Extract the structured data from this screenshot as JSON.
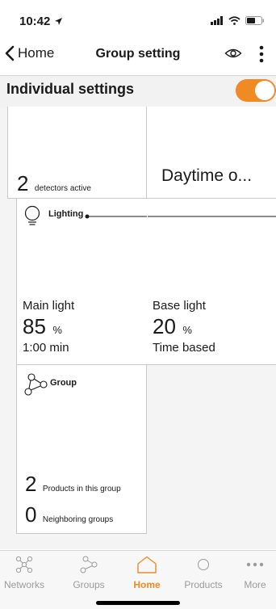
{
  "status_bar": {
    "time": "10:42"
  },
  "nav": {
    "back_label": "Home",
    "title": "Group setting"
  },
  "section": {
    "title": "Individual settings",
    "toggle_on": true
  },
  "tiles": {
    "detectors": {
      "count": "2",
      "label": "detectors active"
    },
    "daytime": {
      "text": "Daytime o..."
    },
    "lighting": {
      "title": "Lighting",
      "main_label": "Main light",
      "main_value": "85",
      "main_unit": "%",
      "main_time": "1:00 min",
      "base_label": "Base light",
      "base_value": "20",
      "base_unit": "%",
      "base_mode": "Time based"
    },
    "group": {
      "title": "Group",
      "products_count": "2",
      "products_label": "Products in this group",
      "neighbors_count": "0",
      "neighbors_label": "Neighboring groups"
    }
  },
  "tabs": [
    {
      "label": "Networks",
      "icon": "networks-icon"
    },
    {
      "label": "Groups",
      "icon": "groups-icon"
    },
    {
      "label": "Home",
      "icon": "home-icon",
      "active": true
    },
    {
      "label": "Products",
      "icon": "products-icon"
    },
    {
      "label": "More",
      "icon": "more-icon"
    }
  ],
  "colors": {
    "accent": "#f08a24",
    "tile_border": "#c8c8c8",
    "background": "#f4f4f4"
  }
}
